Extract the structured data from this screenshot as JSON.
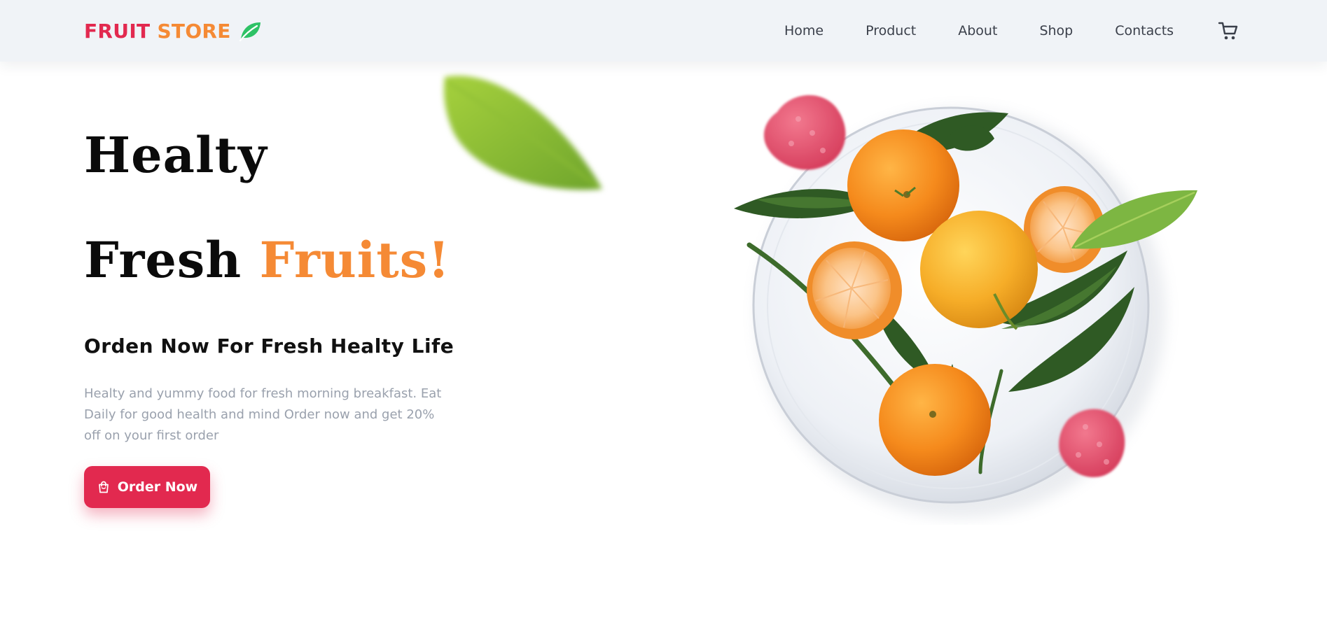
{
  "brand": {
    "name_part1": "FRUIT",
    "name_part2": "STORE",
    "icon": "leaf-icon",
    "color_primary": "#e2294f",
    "color_secondary": "#f58a35",
    "icon_color": "#2ec266"
  },
  "nav": {
    "items": [
      {
        "label": "Home"
      },
      {
        "label": "Product"
      },
      {
        "label": "About"
      },
      {
        "label": "Shop"
      },
      {
        "label": "Contacts"
      }
    ],
    "cart_icon": "cart-icon"
  },
  "hero": {
    "line1": "Healty",
    "line2_plain": "Fresh ",
    "line2_accent": "Fruits!",
    "accent_color": "#f58a35",
    "subheading": "Orden Now For Fresh Healty Life",
    "description": "Healty and yummy food for fresh morning breakfast. Eat Daily for good health and mind Order now and get 20% off on your first order",
    "cta": {
      "label": "Order Now",
      "icon": "shopping-bag-icon",
      "color": "#e2294f"
    }
  },
  "imagery": {
    "floating_leaf": "blurred-leaf",
    "main_image": "plate-of-oranges"
  }
}
